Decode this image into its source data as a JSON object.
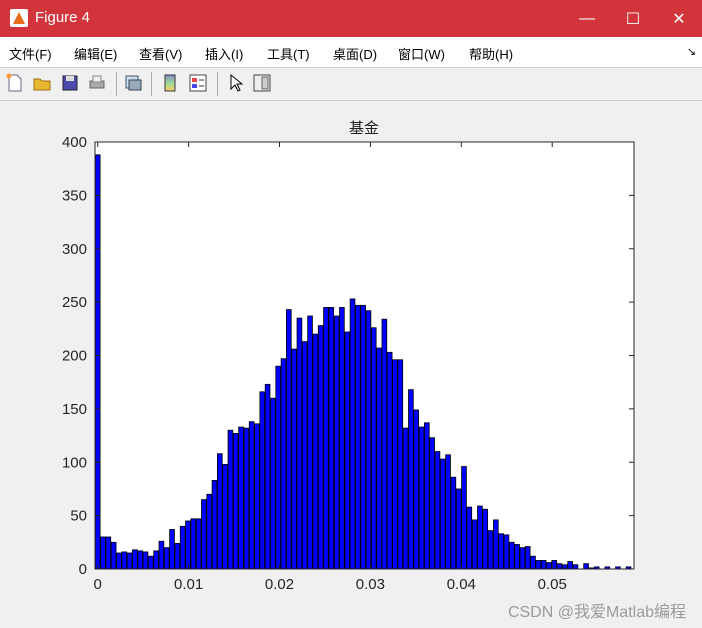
{
  "window": {
    "title": "Figure 4",
    "minimize": "—",
    "maximize": "☐",
    "close": "✕"
  },
  "menu": [
    {
      "label": "文件(F)"
    },
    {
      "label": "编辑(E)"
    },
    {
      "label": "查看(V)"
    },
    {
      "label": "插入(I)"
    },
    {
      "label": "工具(T)"
    },
    {
      "label": "桌面(D)"
    },
    {
      "label": "窗口(W)"
    },
    {
      "label": "帮助(H)"
    }
  ],
  "menu_dock_arrow": "↘",
  "toolbar": [
    "new-figure-icon",
    "open-icon",
    "save-icon",
    "print-icon",
    "link-plot-icon",
    "colorbar-icon",
    "legend-icon",
    "pointer-icon",
    "property-editor-icon"
  ],
  "watermark": "CSDN @我爱Matlab编程",
  "colors": {
    "bar_fill": "#0000ff",
    "bar_edge": "#000000",
    "titlebar": "#d1343a"
  },
  "chart_data": {
    "type": "bar",
    "title": "基金",
    "xlabel": "",
    "ylabel": "",
    "xlim": [
      -0.0003,
      0.059
    ],
    "ylim": [
      0,
      400
    ],
    "xticks": [
      0,
      0.01,
      0.02,
      0.03,
      0.04,
      0.05
    ],
    "xtick_labels": [
      "0",
      "0.01",
      "0.02",
      "0.03",
      "0.04",
      "0.05"
    ],
    "yticks": [
      0,
      50,
      100,
      150,
      200,
      250,
      300,
      350,
      400
    ],
    "ytick_labels": [
      "0",
      "50",
      "100",
      "150",
      "200",
      "250",
      "300",
      "350",
      "400"
    ],
    "bin_width": 0.000584,
    "bin_start": 0,
    "values": [
      388,
      30,
      30,
      25,
      15,
      16,
      15,
      18,
      17,
      16,
      12,
      17,
      26,
      20,
      37,
      24,
      40,
      45,
      47,
      47,
      65,
      70,
      83,
      108,
      98,
      130,
      127,
      133,
      132,
      138,
      136,
      166,
      173,
      160,
      190,
      197,
      243,
      206,
      235,
      213,
      237,
      220,
      228,
      245,
      245,
      237,
      245,
      222,
      253,
      247,
      247,
      242,
      226,
      207,
      234,
      203,
      196,
      196,
      132,
      168,
      149,
      133,
      137,
      123,
      110,
      103,
      107,
      86,
      75,
      96,
      58,
      46,
      59,
      56,
      36,
      46,
      33,
      32,
      25,
      23,
      20,
      21,
      12,
      8,
      8,
      6,
      8,
      5,
      4,
      7,
      4,
      0,
      5,
      1,
      2,
      0,
      2,
      0,
      2,
      0,
      2
    ],
    "grid": false
  }
}
